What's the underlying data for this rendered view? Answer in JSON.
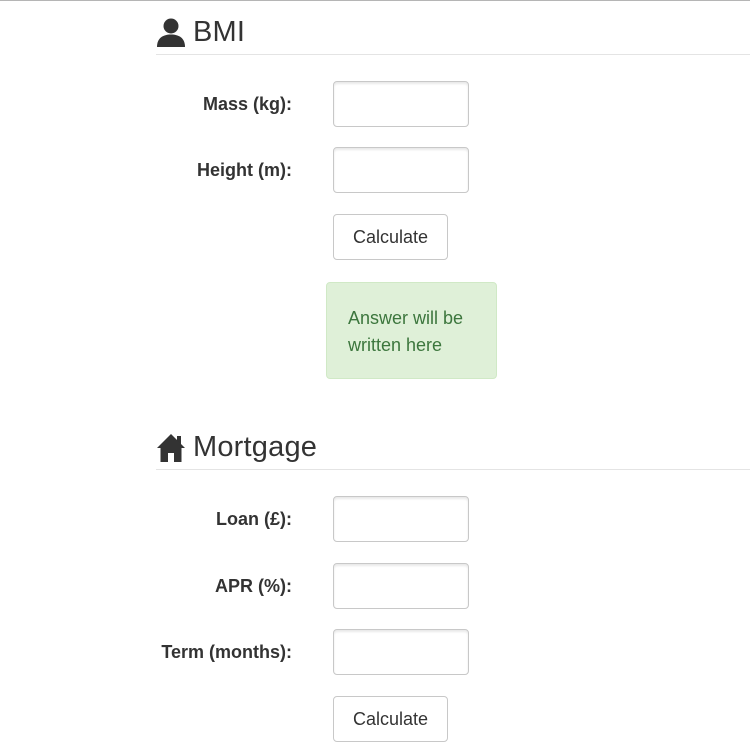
{
  "bmi": {
    "title": "BMI",
    "icon": "user-icon",
    "fields": [
      {
        "label": "Mass (kg):",
        "value": ""
      },
      {
        "label": "Height (m):",
        "value": ""
      }
    ],
    "calculate_label": "Calculate",
    "answer_text": "Answer will be written here"
  },
  "mortgage": {
    "title": "Mortgage",
    "icon": "home-icon",
    "fields": [
      {
        "label": "Loan (£):",
        "value": ""
      },
      {
        "label": "APR (%):",
        "value": ""
      },
      {
        "label": "Term (months):",
        "value": ""
      }
    ],
    "calculate_label": "Calculate"
  },
  "colors": {
    "text": "#333333",
    "answer_bg": "#dff0d8",
    "answer_text": "#3c763d",
    "border": "#c8c8c8"
  }
}
